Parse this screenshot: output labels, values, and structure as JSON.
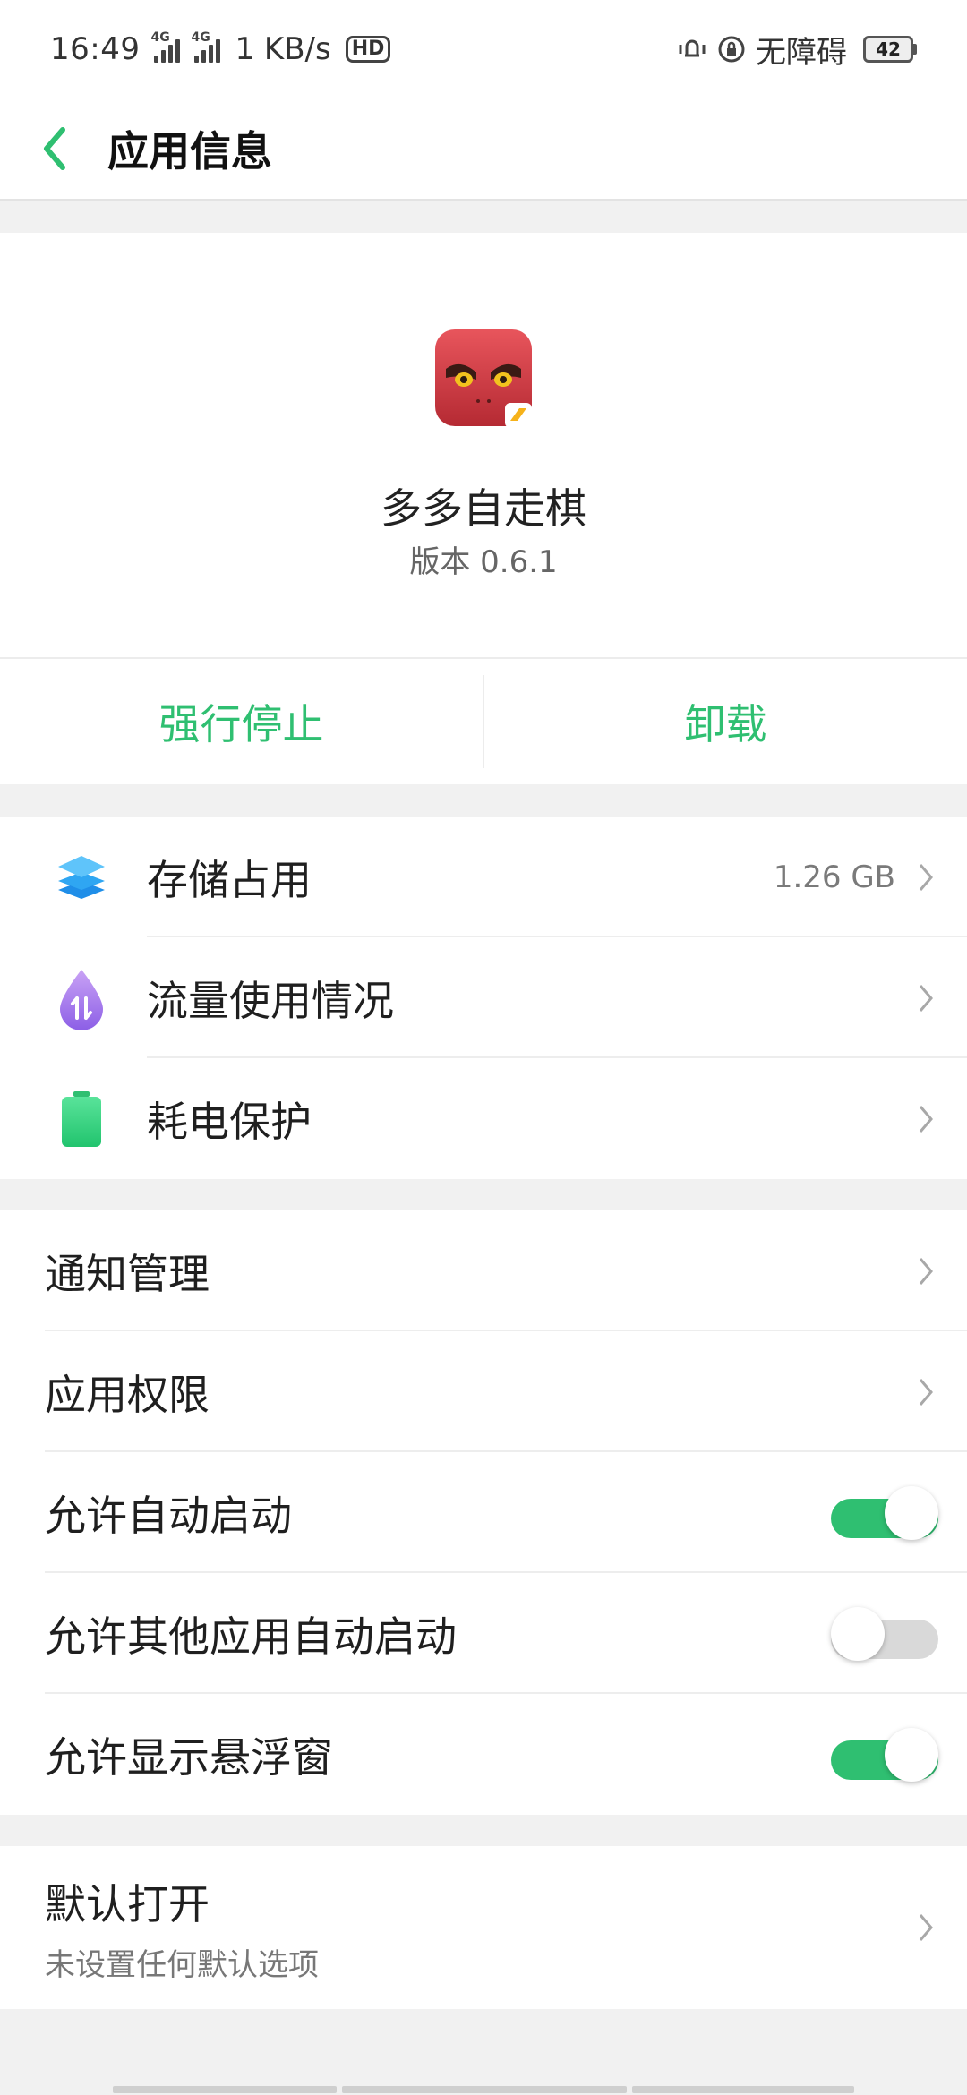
{
  "status_bar": {
    "time": "16:49",
    "network_speed": "1 KB/s",
    "accessibility_label": "无障碍",
    "battery": "42",
    "signal_tags": [
      "4G",
      "4G"
    ]
  },
  "header": {
    "title": "应用信息"
  },
  "app": {
    "name": "多多自走棋",
    "version": "版本 0.6.1"
  },
  "actions": {
    "force_stop": "强行停止",
    "uninstall": "卸载"
  },
  "usage_group": [
    {
      "label": "存储占用",
      "value": "1.26 GB",
      "icon": "storage-layers-icon"
    },
    {
      "label": "流量使用情况",
      "value": "",
      "icon": "data-usage-drop-icon"
    },
    {
      "label": "耗电保护",
      "value": "",
      "icon": "battery-icon"
    }
  ],
  "settings_group": [
    {
      "label": "通知管理",
      "type": "link"
    },
    {
      "label": "应用权限",
      "type": "link"
    },
    {
      "label": "允许自动启动",
      "type": "toggle",
      "on": true
    },
    {
      "label": "允许其他应用自动启动",
      "type": "toggle",
      "on": false
    },
    {
      "label": "允许显示悬浮窗",
      "type": "toggle",
      "on": true
    }
  ],
  "default_open": {
    "label": "默认打开",
    "sub": "未设置任何默认选项"
  },
  "colors": {
    "accent": "#2fbf71",
    "toggle_off": "#d9d9d9",
    "background": "#f1f1f1"
  }
}
